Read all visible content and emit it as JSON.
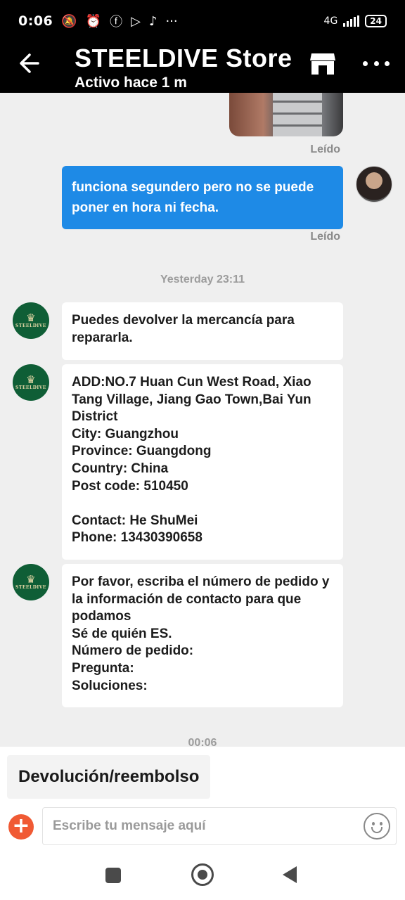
{
  "status_bar": {
    "time": "0:06",
    "network": "4G",
    "battery": "24",
    "icons": [
      "mute-icon",
      "alarm-icon",
      "facebook-icon",
      "play-icon",
      "tiktok-icon",
      "more-dots-icon"
    ]
  },
  "header": {
    "title": "STEELDIVE Store",
    "subtitle": "Activo hace 1 m",
    "icons": [
      "back-arrow-icon",
      "store-icon",
      "more-icon"
    ]
  },
  "messages": {
    "read_label_1": "Leído",
    "outgoing_text": "funciona segundero pero no se puede poner en hora ni fecha.",
    "read_label_2": "Leído",
    "timestamp_1": "Yesterday 23:11",
    "incoming_1": "Puedes devolver la mercancía para repararla.",
    "incoming_2": "ADD:NO.7 Huan Cun West Road, Xiao Tang Village, Jiang Gao Town,Bai Yun District\nCity: Guangzhou\nProvince: Guangdong\nCountry: China\nPost code: 510450\n\nContact: He ShuMei\nPhone: 13430390658",
    "incoming_3": "Por favor, escriba el número de pedido y la información de contacto para que podamos\nSé de quién ES.\nNúmero de pedido:\nPregunta:\nSoluciones:",
    "timestamp_2": "00:06"
  },
  "store_avatar_text": "STEELDIVE",
  "composer": {
    "quick_reply": "Devolución/reembolso",
    "placeholder": "Escribe tu mensaje aquí",
    "plus": "+"
  },
  "colors": {
    "header_bg": "#000000",
    "outgoing_bubble": "#1e8ae6",
    "store_avatar": "#0f5e36",
    "plus_button": "#f05a34"
  }
}
